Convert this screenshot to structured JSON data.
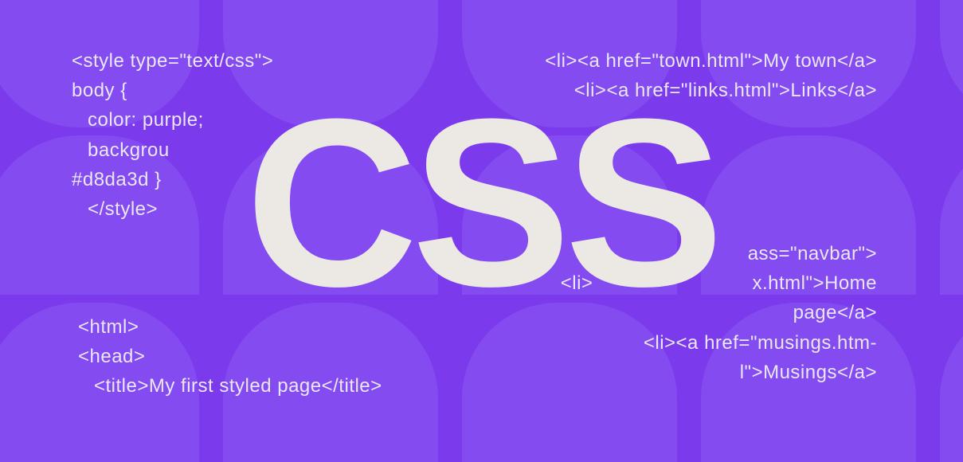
{
  "hero_text": "CSS",
  "code_left_top": {
    "line1": "<style type=\"text/css\">",
    "line2": "body {",
    "line3": "color: purple;",
    "line4": "backgrou",
    "line5": "#d8da3d }",
    "line6": "</style>"
  },
  "code_left_bottom": {
    "line1": "<html>",
    "line2": "<head>",
    "line3": "<title>My first styled page</title>"
  },
  "code_right_top": {
    "line1": "<li><a href=\"town.html\">My town</a>",
    "line2": "<li><a href=\"links.html\">Links</a>"
  },
  "code_right_bottom": {
    "line1": "ass=\"navbar\">",
    "line2": "x.html\">Home",
    "line3": "page</a>",
    "line4": "<li><a href=\"musings.htm-",
    "line5": "l\">Musings</a>"
  },
  "code_right_bottom_prefix": {
    "line2_prefix": "<li>"
  }
}
